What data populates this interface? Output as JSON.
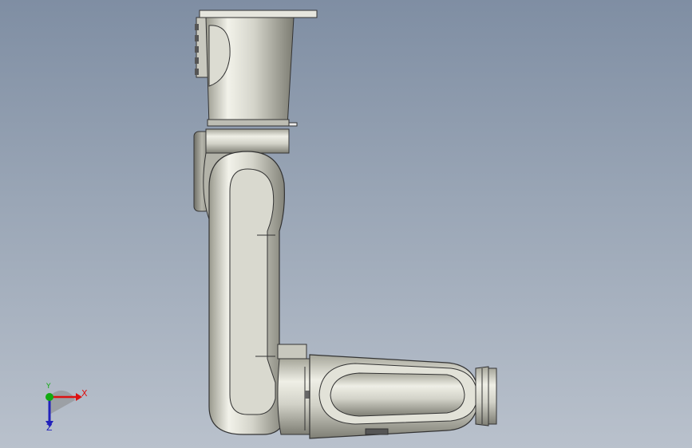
{
  "viewport": {
    "background_top": "#7f8ea3",
    "background_bottom": "#b9c1cc",
    "model": "robot-arm"
  },
  "triad": {
    "x_label": "X",
    "y_label": "Y",
    "z_label": "Z",
    "x_color": "#dd1111",
    "y_color": "#11aa11",
    "z_color": "#2222bb"
  }
}
